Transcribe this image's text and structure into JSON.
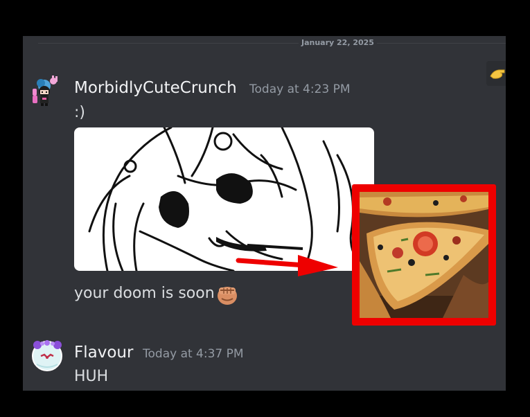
{
  "date_divider": "January 22, 2025",
  "messages": [
    {
      "username": "MorbidlyCuteCrunch",
      "timestamp": "Today at 4:23 PM",
      "lines": [
        ":)",
        "your doom is soon"
      ],
      "attachment": {
        "type": "sketch-image"
      },
      "reaction_emoji": "fist-emoji"
    },
    {
      "username": "Flavour",
      "timestamp": "Today at 4:37 PM",
      "lines": [
        "HUH"
      ]
    }
  ],
  "annotation": {
    "image_subject": "pizza",
    "border_color": "#ee0000",
    "arrow_color": "#ee0000"
  },
  "colors": {
    "background": "#313338",
    "username": "#f2f3f5",
    "timestamp": "#949ba4",
    "text": "#dbdee1",
    "page": "#000000"
  }
}
